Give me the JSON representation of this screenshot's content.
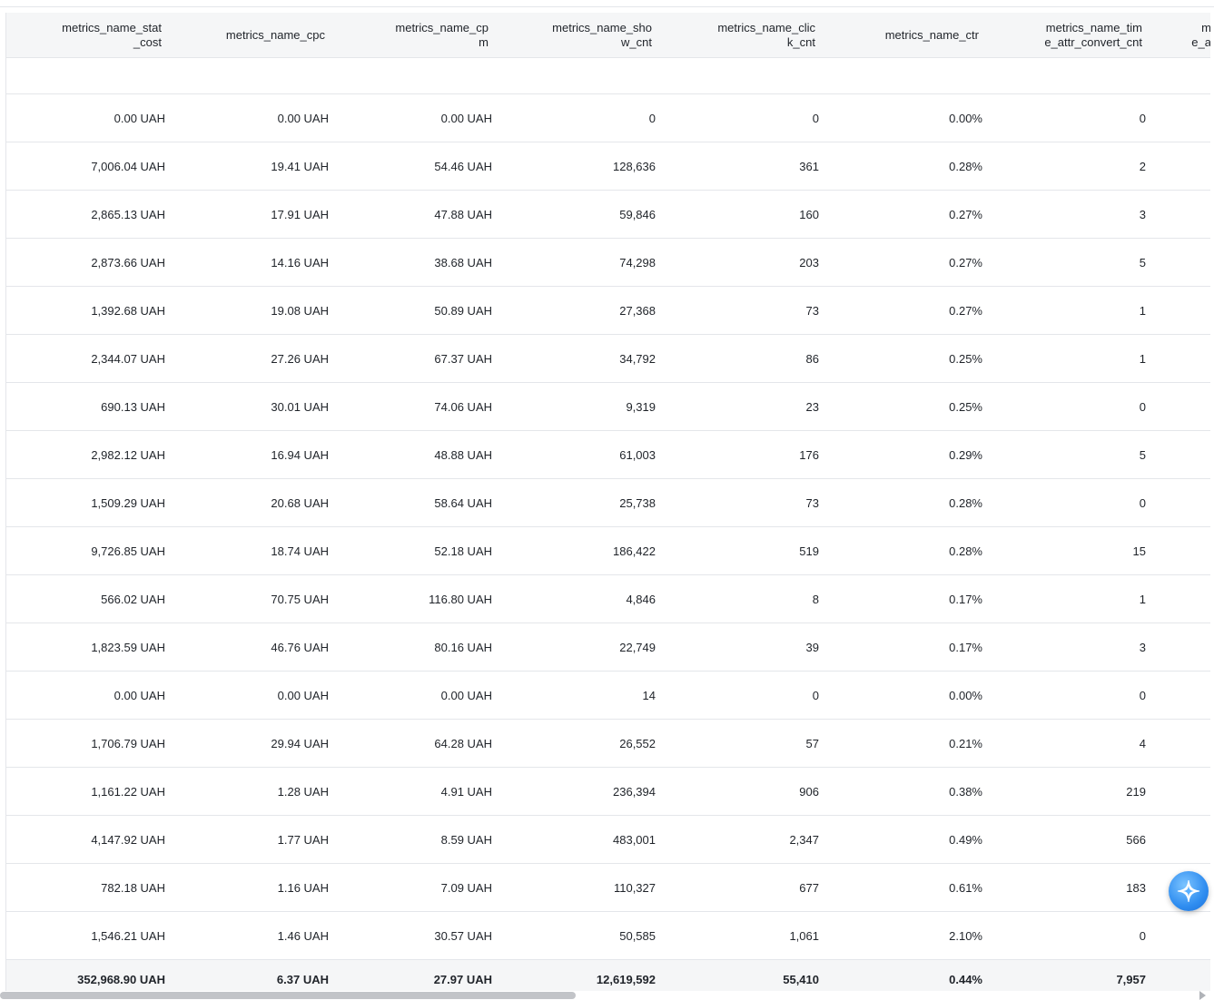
{
  "columns": [
    {
      "key": "stat_cost",
      "lines": [
        "metrics_name_stat",
        "_cost"
      ]
    },
    {
      "key": "cpc",
      "lines": [
        "metrics_name_cpc"
      ]
    },
    {
      "key": "cpm",
      "lines": [
        "metrics_name_cp",
        "m"
      ]
    },
    {
      "key": "show_cnt",
      "lines": [
        "metrics_name_sho",
        "w_cnt"
      ]
    },
    {
      "key": "click_cnt",
      "lines": [
        "metrics_name_clic",
        "k_cnt"
      ]
    },
    {
      "key": "ctr",
      "lines": [
        "metrics_name_ctr"
      ]
    },
    {
      "key": "time_attr_convert_cnt",
      "lines": [
        "metrics_name_tim",
        "e_attr_convert_cnt"
      ]
    },
    {
      "key": "partial",
      "lines": [
        "m",
        "e_a"
      ]
    }
  ],
  "rows": [
    [
      "0.00 UAH",
      "0.00 UAH",
      "0.00 UAH",
      "0",
      "0",
      "0.00%",
      "0"
    ],
    [
      "7,006.04 UAH",
      "19.41 UAH",
      "54.46 UAH",
      "128,636",
      "361",
      "0.28%",
      "2"
    ],
    [
      "2,865.13 UAH",
      "17.91 UAH",
      "47.88 UAH",
      "59,846",
      "160",
      "0.27%",
      "3"
    ],
    [
      "2,873.66 UAH",
      "14.16 UAH",
      "38.68 UAH",
      "74,298",
      "203",
      "0.27%",
      "5"
    ],
    [
      "1,392.68 UAH",
      "19.08 UAH",
      "50.89 UAH",
      "27,368",
      "73",
      "0.27%",
      "1"
    ],
    [
      "2,344.07 UAH",
      "27.26 UAH",
      "67.37 UAH",
      "34,792",
      "86",
      "0.25%",
      "1"
    ],
    [
      "690.13 UAH",
      "30.01 UAH",
      "74.06 UAH",
      "9,319",
      "23",
      "0.25%",
      "0"
    ],
    [
      "2,982.12 UAH",
      "16.94 UAH",
      "48.88 UAH",
      "61,003",
      "176",
      "0.29%",
      "5"
    ],
    [
      "1,509.29 UAH",
      "20.68 UAH",
      "58.64 UAH",
      "25,738",
      "73",
      "0.28%",
      "0"
    ],
    [
      "9,726.85 UAH",
      "18.74 UAH",
      "52.18 UAH",
      "186,422",
      "519",
      "0.28%",
      "15"
    ],
    [
      "566.02 UAH",
      "70.75 UAH",
      "116.80 UAH",
      "4,846",
      "8",
      "0.17%",
      "1"
    ],
    [
      "1,823.59 UAH",
      "46.76 UAH",
      "80.16 UAH",
      "22,749",
      "39",
      "0.17%",
      "3"
    ],
    [
      "0.00 UAH",
      "0.00 UAH",
      "0.00 UAH",
      "14",
      "0",
      "0.00%",
      "0"
    ],
    [
      "1,706.79 UAH",
      "29.94 UAH",
      "64.28 UAH",
      "26,552",
      "57",
      "0.21%",
      "4"
    ],
    [
      "1,161.22 UAH",
      "1.28 UAH",
      "4.91 UAH",
      "236,394",
      "906",
      "0.38%",
      "219"
    ],
    [
      "4,147.92 UAH",
      "1.77 UAH",
      "8.59 UAH",
      "483,001",
      "2,347",
      "0.49%",
      "566"
    ],
    [
      "782.18 UAH",
      "1.16 UAH",
      "7.09 UAH",
      "110,327",
      "677",
      "0.61%",
      "183"
    ],
    [
      "1,546.21 UAH",
      "1.46 UAH",
      "30.57 UAH",
      "50,585",
      "1,061",
      "2.10%",
      "0"
    ]
  ],
  "totals": [
    "352,968.90 UAH",
    "6.37 UAH",
    "27.97 UAH",
    "12,619,592",
    "55,410",
    "0.44%",
    "7,957"
  ],
  "icons": {
    "assistant": "sparkle-icon"
  },
  "colors": {
    "header_bg": "#f5f6f7",
    "border": "#e4e6ea",
    "text": "#1f2329",
    "fab": "#2f8df0"
  }
}
